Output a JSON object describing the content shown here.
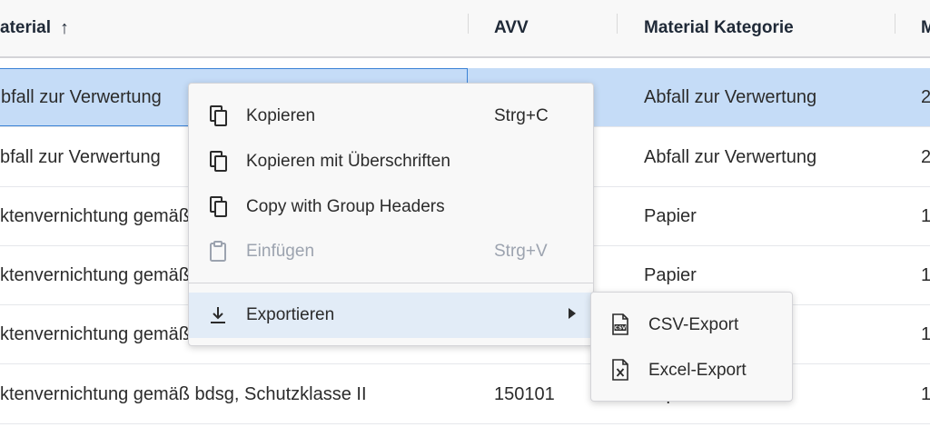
{
  "columns": {
    "material": "aterial",
    "avv": "AVV",
    "kategorie": "Material Kategorie",
    "m": "M"
  },
  "rows": [
    {
      "material": "bfall zur Verwertung",
      "avv": "",
      "kategorie": "Abfall zur Verwertung",
      "m": "2",
      "selected": true
    },
    {
      "material": "bfall zur Verwertung",
      "avv": "",
      "kategorie": "Abfall zur Verwertung",
      "m": "2",
      "selected": false
    },
    {
      "material": "ktenvernichtung gemäß bdsg, Schutzklasse II",
      "avv": "",
      "kategorie": "Papier",
      "m": "1",
      "selected": false
    },
    {
      "material": "ktenvernichtung gemäß bdsg, Schutzklasse II",
      "avv": "",
      "kategorie": "Papier",
      "m": "1",
      "selected": false
    },
    {
      "material": "ktenvernichtung gemäß bdsg, Schutzklasse II",
      "avv": "",
      "kategorie": "",
      "m": "1",
      "selected": false
    },
    {
      "material": "ktenvernichtung gemäß bdsg, Schutzklasse II",
      "avv": "150101",
      "kategorie": "Papier",
      "m": "1",
      "selected": false
    }
  ],
  "context_menu": {
    "items": [
      {
        "label": "Kopieren",
        "shortcut": "Strg+C",
        "icon": "copy-icon",
        "disabled": false
      },
      {
        "label": "Kopieren mit Überschriften",
        "shortcut": "",
        "icon": "copy-icon",
        "disabled": false
      },
      {
        "label": "Copy with Group Headers",
        "shortcut": "",
        "icon": "copy-icon",
        "disabled": false
      },
      {
        "label": "Einfügen",
        "shortcut": "Strg+V",
        "icon": "paste-icon",
        "disabled": true
      }
    ],
    "export": {
      "label": "Exportieren",
      "icon": "download-icon"
    }
  },
  "export_submenu": {
    "items": [
      {
        "label": "CSV-Export",
        "icon": "csv-file-icon"
      },
      {
        "label": "Excel-Export",
        "icon": "excel-file-icon"
      }
    ]
  },
  "colors": {
    "selected_row": "#c5dcf7",
    "selected_border": "#3b82d6",
    "menu_active": "#e2ecf7",
    "disabled_text": "#9ca3af"
  }
}
